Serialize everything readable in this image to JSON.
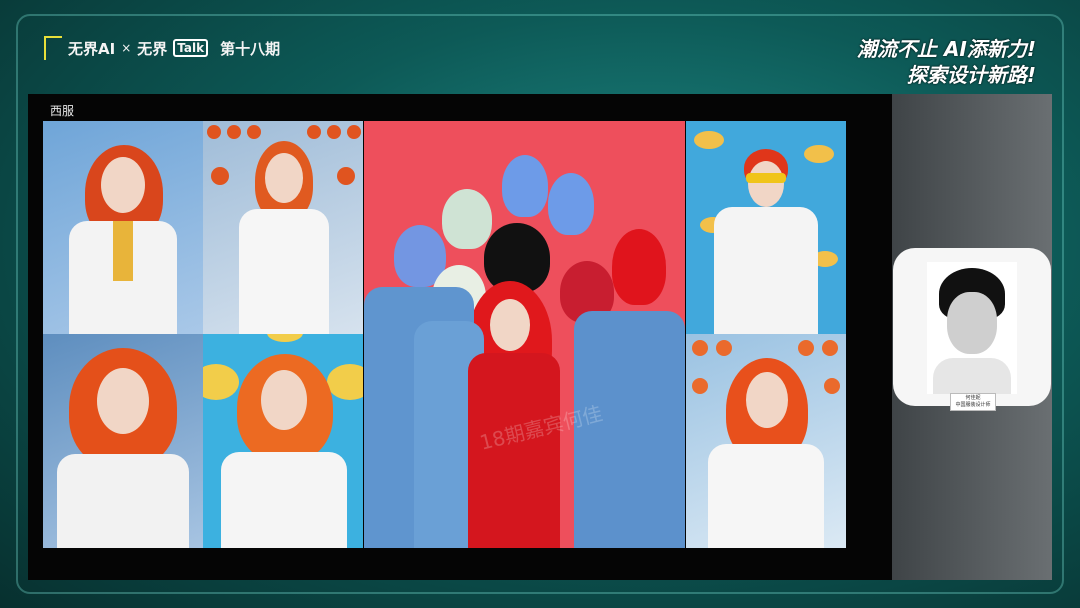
{
  "brand": {
    "logo_text": "无界AI",
    "separator": "×",
    "talk_prefix": "无界",
    "talk_box": "Talk",
    "episode": "第十八期"
  },
  "slogan": {
    "line1": "潮流不止 AI添新力!",
    "line2": "探索设计新路!"
  },
  "slide": {
    "title": "西服"
  },
  "speaker": {
    "name": "何佳妮",
    "role": "中国服装设计师"
  },
  "watermark": "18期嘉宾何佳",
  "colors": {
    "accent": "#e8e03a",
    "background_teal": "#1f8a86",
    "red_backdrop": "#ee4f5c",
    "blue_backdrop": "#41a8dc"
  }
}
